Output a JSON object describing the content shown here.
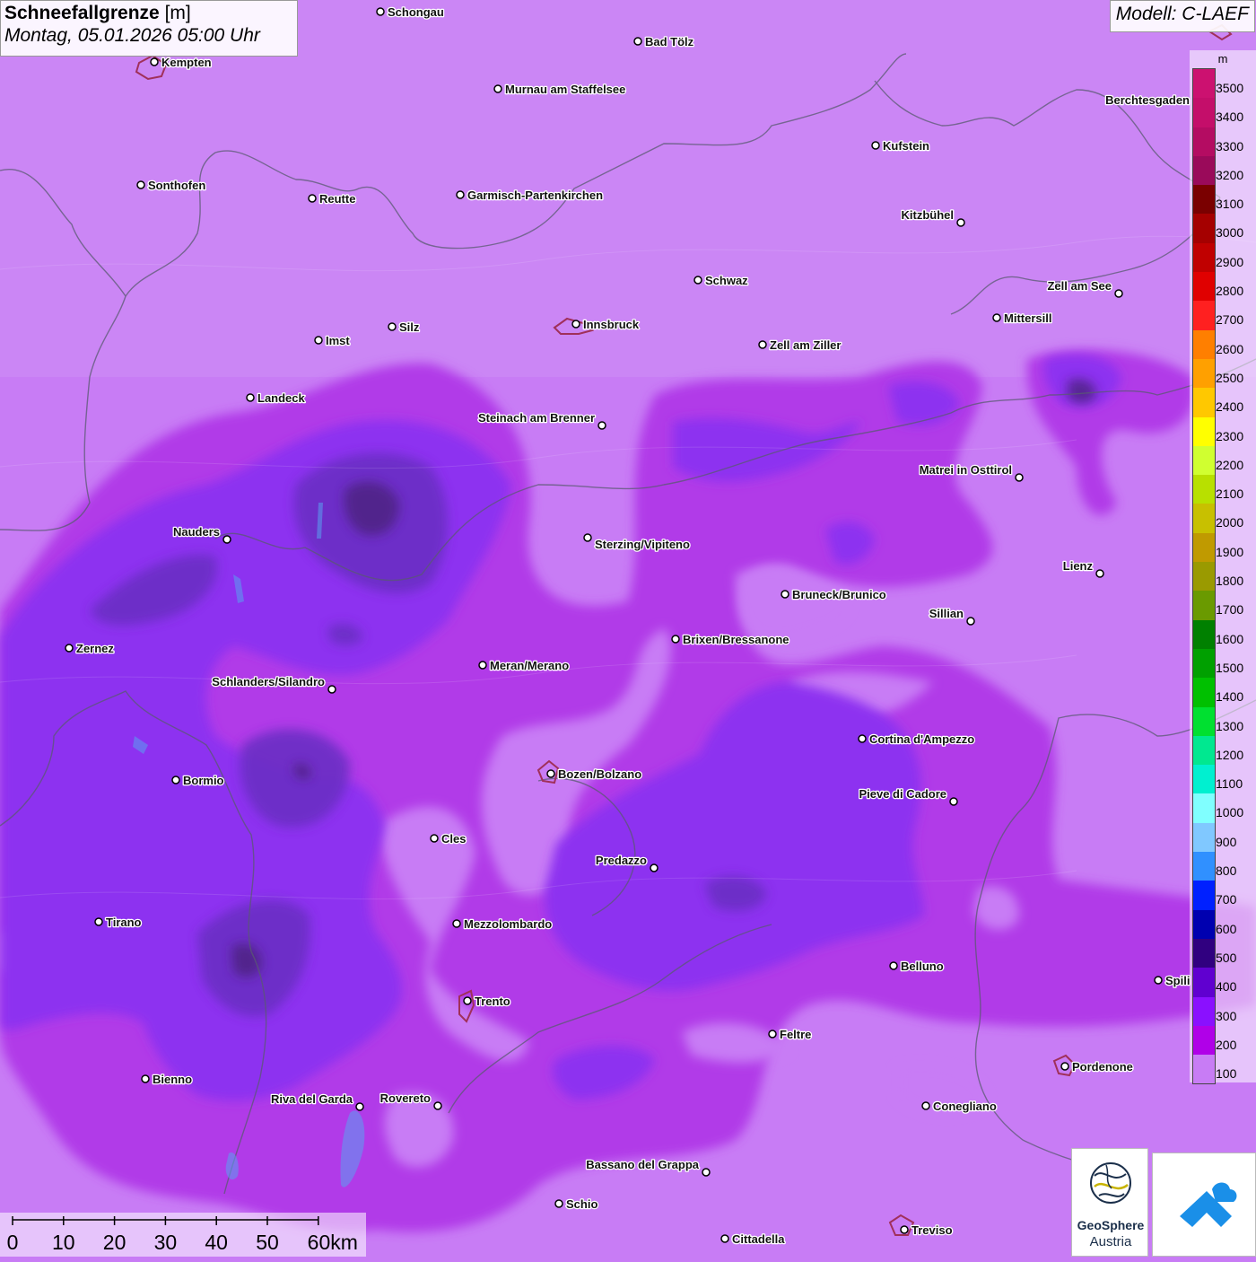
{
  "title": {
    "variable": "Schneefallgrenze",
    "unit": "[m]",
    "datetime": "Montag, 05.01.2026 05:00 Uhr"
  },
  "model_label": "Modell: C-LAEF",
  "legend": {
    "unit": "m",
    "steps": [
      {
        "label": "3500",
        "color": "#cc1170"
      },
      {
        "label": "3400",
        "color": "#c40e6a"
      },
      {
        "label": "3300",
        "color": "#b40c62"
      },
      {
        "label": "3200",
        "color": "#9a0a5a"
      },
      {
        "label": "3100",
        "color": "#7a0000"
      },
      {
        "label": "3000",
        "color": "#a50000"
      },
      {
        "label": "2900",
        "color": "#c00000"
      },
      {
        "label": "2800",
        "color": "#e00000"
      },
      {
        "label": "2700",
        "color": "#ff2020"
      },
      {
        "label": "2600",
        "color": "#ff7f00"
      },
      {
        "label": "2500",
        "color": "#ffa000"
      },
      {
        "label": "2400",
        "color": "#ffc800"
      },
      {
        "label": "2300",
        "color": "#ffff00"
      },
      {
        "label": "2200",
        "color": "#d0ff30"
      },
      {
        "label": "2100",
        "color": "#b8e000"
      },
      {
        "label": "2000",
        "color": "#c8c000"
      },
      {
        "label": "1900",
        "color": "#c09a00"
      },
      {
        "label": "1800",
        "color": "#9a9a00"
      },
      {
        "label": "1700",
        "color": "#6a9a00"
      },
      {
        "label": "1600",
        "color": "#008000"
      },
      {
        "label": "1500",
        "color": "#00a000"
      },
      {
        "label": "1400",
        "color": "#00c000"
      },
      {
        "label": "1300",
        "color": "#00e030"
      },
      {
        "label": "1200",
        "color": "#00e890"
      },
      {
        "label": "1100",
        "color": "#00f0d0"
      },
      {
        "label": "1000",
        "color": "#80ffff"
      },
      {
        "label": "900",
        "color": "#80c8ff"
      },
      {
        "label": "800",
        "color": "#3090ff"
      },
      {
        "label": "700",
        "color": "#0020ff"
      },
      {
        "label": "600",
        "color": "#0000b0"
      },
      {
        "label": "500",
        "color": "#300080"
      },
      {
        "label": "400",
        "color": "#6000d0"
      },
      {
        "label": "300",
        "color": "#8a10ff"
      },
      {
        "label": "200",
        "color": "#b000e8"
      },
      {
        "label": "100",
        "color": "#c87cf5"
      }
    ]
  },
  "scalebar": {
    "labels": [
      "0",
      "10",
      "20",
      "30",
      "40",
      "50",
      "60km"
    ]
  },
  "cities": [
    "Schongau",
    "Bad Tölz",
    "Kempten",
    "Murnau am Staffelsee",
    "Berchtesgaden",
    "Kufstein",
    "Sonthofen",
    "Reutte",
    "Garmisch-Partenkirchen",
    "Kitzbühel",
    "Schwaz",
    "Zell am See",
    "Innsbruck",
    "Silz",
    "Imst",
    "Mittersill",
    "Zell am Ziller",
    "Landeck",
    "Steinach am Brenner",
    "Matrei in Osttirol",
    "Nauders",
    "Sterzing/Vipiteno",
    "Lienz",
    "Bruneck/Brunico",
    "Sillian",
    "Zernez",
    "Brixen/Bressanone",
    "Meran/Merano",
    "Schlanders/Silandro",
    "Cortina d'Ampezzo",
    "Bozen/Bolzano",
    "Bormio",
    "Pieve di Cadore",
    "Cles",
    "Predazzo",
    "Tirano",
    "Mezzolombardo",
    "Belluno",
    "Spili",
    "Trento",
    "Feltre",
    "Pordenone",
    "Bienno",
    "Riva del Garda",
    "Rovereto",
    "Conegliano",
    "Bassano del Grappa",
    "Schio",
    "Treviso",
    "Cittadella"
  ],
  "logos": {
    "geosphere_line1": "GeoSphere",
    "geosphere_line2": "Austria"
  },
  "colors": {
    "background_band": "#c87cf5",
    "band_200": "#b13ae8",
    "band_300": "#8d33f0",
    "band_400": "#6a2fc4",
    "band_500": "#4b237e"
  }
}
